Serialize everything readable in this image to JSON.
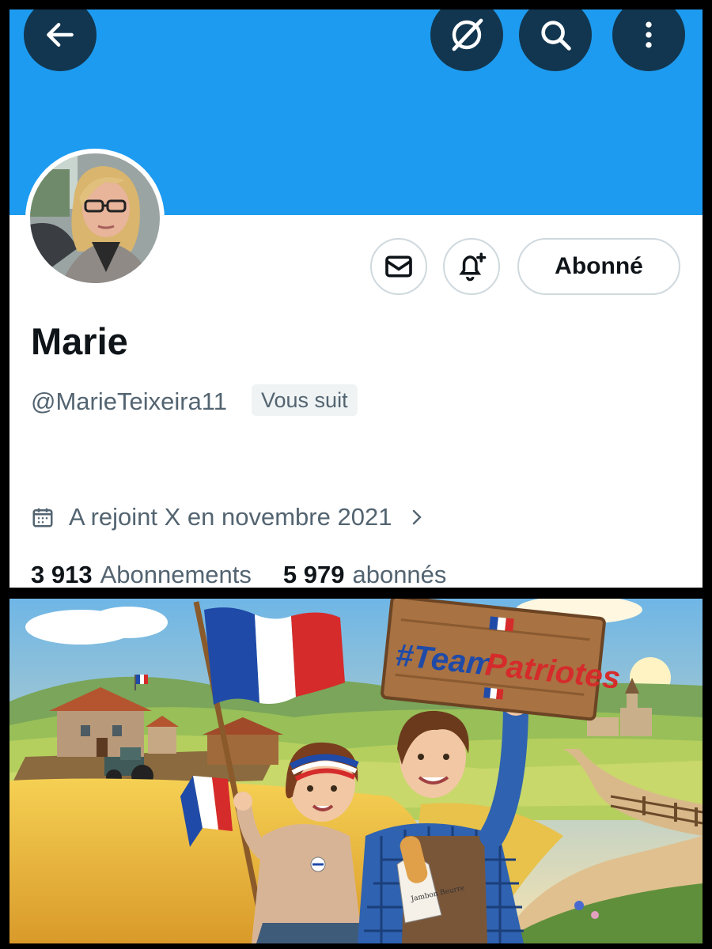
{
  "header": {
    "back_icon": "arrow-left-icon",
    "grok_icon": "grok-slash-icon",
    "search_icon": "search-icon",
    "more_icon": "more-vertical-icon"
  },
  "colors": {
    "banner": "#1d9bf0",
    "text_primary": "#0f1419",
    "text_secondary": "#536471",
    "border": "#cfd9de"
  },
  "profile": {
    "name": "Marie",
    "handle": "@MarieTeixeira11",
    "follows_you_badge": "Vous suit",
    "joined": "A rejoint X en novembre 2021",
    "following_count": "3 913",
    "following_label": "Abonnements",
    "followers_count": "5 979",
    "followers_label": "abonnés"
  },
  "actions": {
    "message_icon": "envelope-icon",
    "notify_icon": "bell-plus-icon",
    "follow_label": "Abonné"
  },
  "media": {
    "sign_text_part1": "#Team",
    "sign_text_part2": "Patriotes",
    "bag_text": "Jambon Beurre"
  }
}
